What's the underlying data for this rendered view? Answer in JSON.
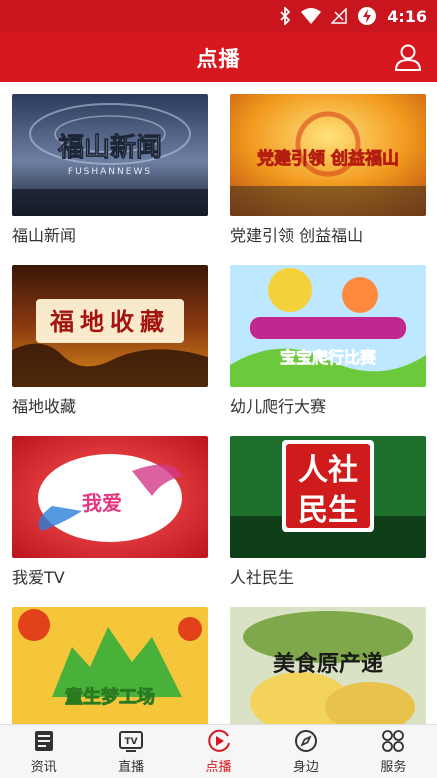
{
  "status_bar": {
    "time": "4:16"
  },
  "header": {
    "title": "点播"
  },
  "programs": [
    {
      "caption": "福山新闻",
      "thumb_text": "福山新闻",
      "thumb_subtext": "FUSHANNEWS"
    },
    {
      "caption": "党建引领 创益福山",
      "thumb_text": "党建引领 创益福山"
    },
    {
      "caption": "福地收藏",
      "thumb_text": "福地收藏"
    },
    {
      "caption": "幼儿爬行大赛",
      "thumb_text": "宝宝爬行比赛"
    },
    {
      "caption": "我爱TV",
      "thumb_text": "我爱"
    },
    {
      "caption": "人社民生",
      "thumb_text_1": "人社",
      "thumb_text_2": "民生"
    },
    {
      "caption": "",
      "thumb_text": "童生梦工场"
    },
    {
      "caption": "",
      "thumb_text": "美食原产递"
    }
  ],
  "bottom_nav": [
    {
      "label": "资讯",
      "icon": "news-icon",
      "active": false
    },
    {
      "label": "直播",
      "icon": "tv-icon",
      "tv_text": "TV",
      "active": false
    },
    {
      "label": "点播",
      "icon": "play-icon",
      "active": true
    },
    {
      "label": "身边",
      "icon": "compass-icon",
      "active": false
    },
    {
      "label": "服务",
      "icon": "grid-icon",
      "active": false
    }
  ],
  "colors": {
    "brand": "#d7181f",
    "status_bar": "#c9151e",
    "nav_bg": "#f6f6f6",
    "text": "#333333"
  }
}
